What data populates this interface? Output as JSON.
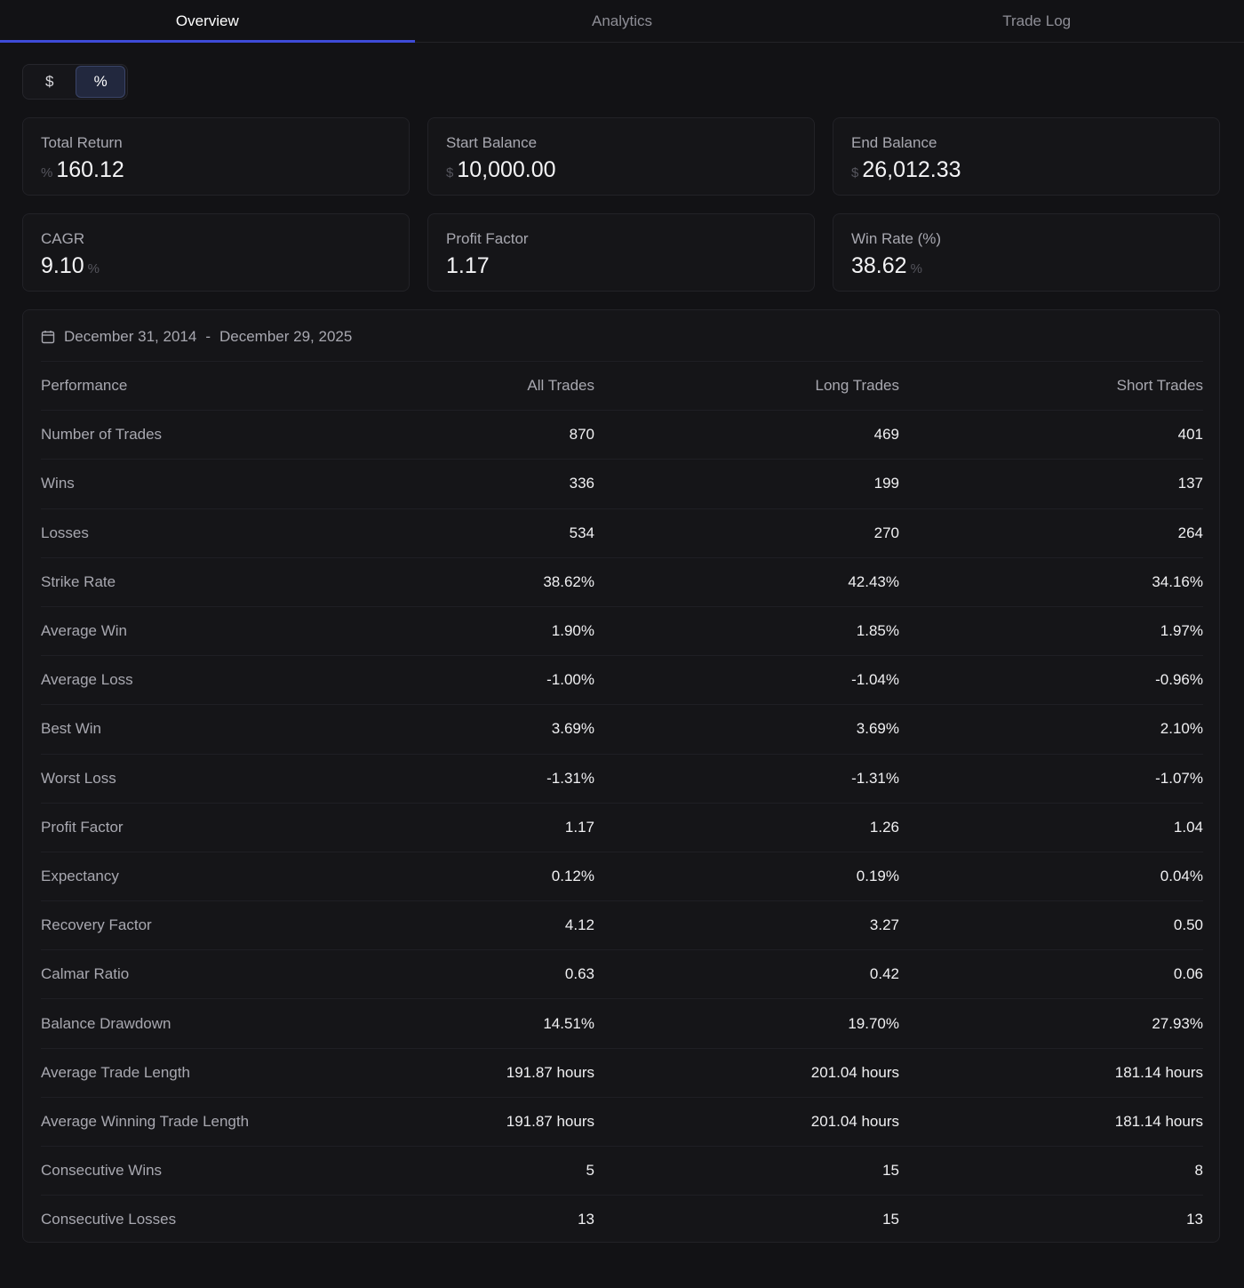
{
  "tabs": [
    {
      "label": "Overview",
      "active": true
    },
    {
      "label": "Analytics",
      "active": false
    },
    {
      "label": "Trade Log",
      "active": false
    }
  ],
  "toggle": {
    "dollar": "$",
    "percent": "%",
    "selected": "%"
  },
  "cards": [
    {
      "label": "Total Return",
      "prefix": "%",
      "value": "160.12",
      "suffix": ""
    },
    {
      "label": "Start Balance",
      "prefix": "$",
      "value": "10,000.00",
      "suffix": ""
    },
    {
      "label": "End Balance",
      "prefix": "$",
      "value": "26,012.33",
      "suffix": ""
    },
    {
      "label": "CAGR",
      "prefix": "",
      "value": "9.10",
      "suffix": "%"
    },
    {
      "label": "Profit Factor",
      "prefix": "",
      "value": "1.17",
      "suffix": ""
    },
    {
      "label": "Win Rate (%)",
      "prefix": "",
      "value": "38.62",
      "suffix": "%"
    }
  ],
  "date_range": {
    "start": "December 31, 2014",
    "separator": "-",
    "end": "December 29, 2025",
    "icon": "calendar-icon"
  },
  "table": {
    "headers": [
      "Performance",
      "All Trades",
      "Long Trades",
      "Short Trades"
    ],
    "rows": [
      [
        "Number of Trades",
        "870",
        "469",
        "401"
      ],
      [
        "Wins",
        "336",
        "199",
        "137"
      ],
      [
        "Losses",
        "534",
        "270",
        "264"
      ],
      [
        "Strike Rate",
        "38.62%",
        "42.43%",
        "34.16%"
      ],
      [
        "Average Win",
        "1.90%",
        "1.85%",
        "1.97%"
      ],
      [
        "Average Loss",
        "-1.00%",
        "-1.04%",
        "-0.96%"
      ],
      [
        "Best Win",
        "3.69%",
        "3.69%",
        "2.10%"
      ],
      [
        "Worst Loss",
        "-1.31%",
        "-1.31%",
        "-1.07%"
      ],
      [
        "Profit Factor",
        "1.17",
        "1.26",
        "1.04"
      ],
      [
        "Expectancy",
        "0.12%",
        "0.19%",
        "0.04%"
      ],
      [
        "Recovery Factor",
        "4.12",
        "3.27",
        "0.50"
      ],
      [
        "Calmar Ratio",
        "0.63",
        "0.42",
        "0.06"
      ],
      [
        "Balance Drawdown",
        "14.51%",
        "19.70%",
        "27.93%"
      ],
      [
        "Average Trade Length",
        "191.87 hours",
        "201.04 hours",
        "181.14 hours"
      ],
      [
        "Average Winning Trade Length",
        "191.87 hours",
        "201.04 hours",
        "181.14 hours"
      ],
      [
        "Consecutive Wins",
        "5",
        "15",
        "8"
      ],
      [
        "Consecutive Losses",
        "13",
        "15",
        "13"
      ]
    ]
  },
  "colors": {
    "accent": "#3e4bd8",
    "background": "#121215",
    "card": "#151518"
  }
}
